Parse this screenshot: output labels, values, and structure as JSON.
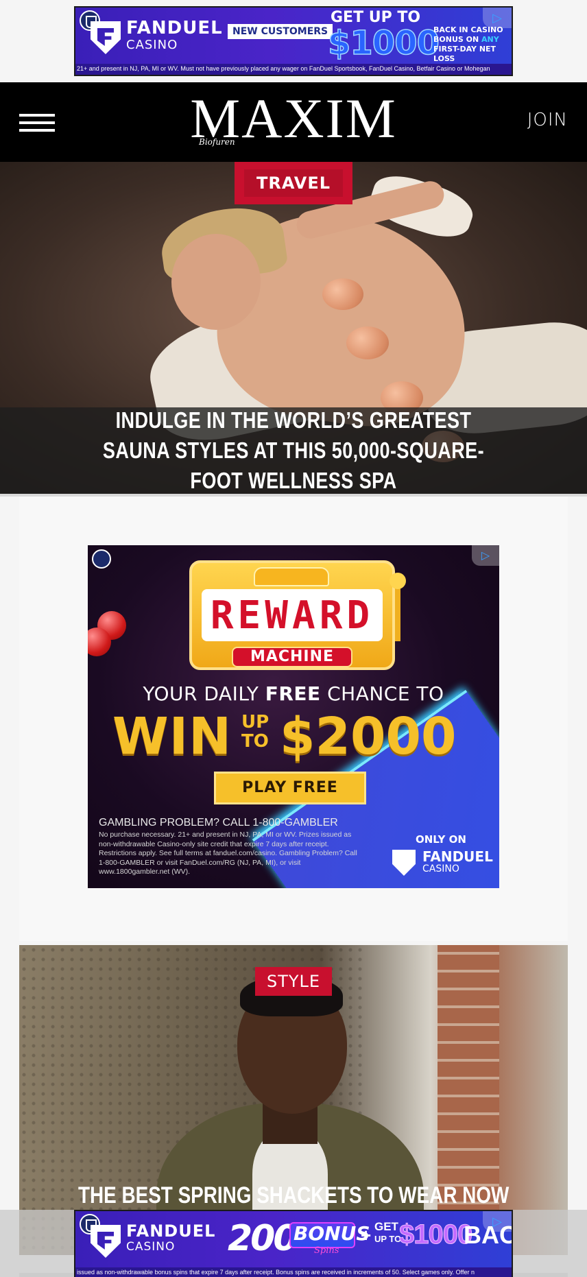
{
  "top_ad": {
    "brand": "FANDUEL",
    "brand_sub": "CASINO",
    "tag": "NEW CUSTOMERS",
    "headline": "GET UP TO",
    "amount": "$1000",
    "bonus_line1": "BACK IN CASINO",
    "bonus_line2_a": "BONUS ON ",
    "bonus_line2_b": "ANY",
    "bonus_line3": "FIRST-DAY NET LOSS",
    "fine_print": "21+ and present in NJ, PA, MI or WV. Must not have previously placed any wager on FanDuel Sportsbook, FanDuel Casino, Betfair Casino or Mohegan",
    "adchoices_icon": "adchoices-icon"
  },
  "header": {
    "logo": "MAXIM",
    "logo_script": "Biofuren",
    "join": "JOIN",
    "menu_icon": "hamburger-menu-icon"
  },
  "hero1": {
    "category": "TRAVEL",
    "title": "INDULGE IN THE WORLD’S GREATEST SAUNA STYLES AT THIS 50,000-SQUARE-FOOT WELLNESS SPA"
  },
  "mid_ad": {
    "slot_text": "REWARD",
    "slot_label": "MACHINE",
    "line1_a": "YOUR DAILY ",
    "line1_b": "FREE",
    "line1_c": " CHANCE TO",
    "win": "WIN",
    "upto": "UP TO",
    "amount": "$2000",
    "cta": "PLAY FREE",
    "gambling": "GAMBLING PROBLEM? CALL 1-800-GAMBLER",
    "fine_print": "No purchase necessary. 21+ and present in NJ, PA, MI or WV. Prizes issued as non-withdrawable Casino-only site credit that expire 7 days after receipt. Restrictions apply. See full terms at fanduel.com/casino. Gambling Problem? Call 1-800-GAMBLER or visit FanDuel.com/RG (NJ, PA, MI), or visit www.1800gambler.net (WV).",
    "only_on": "ONLY ON",
    "brand": "FANDUEL",
    "brand_sub": "CASINO"
  },
  "hero2": {
    "category": "STYLE",
    "title": "THE BEST SPRING SHACKETS TO WEAR NOW"
  },
  "bottom_ad": {
    "brand": "FANDUEL",
    "brand_sub": "CASINO",
    "count": "200",
    "bonus": "BONUS",
    "spins": "Spins",
    "plus": "+",
    "get": "GET",
    "upto": "UP TO",
    "amount": "$1000",
    "back": "BACK",
    "fine_print": "issued as non-withdrawable bonus spins that expire 7 days after receipt. Bonus spins are received in increments of 50. Select games only. Offer n"
  },
  "colors": {
    "accent_red": "#c8102e",
    "fanduel_purple": "#3a1fb8",
    "header_black": "#000000"
  }
}
